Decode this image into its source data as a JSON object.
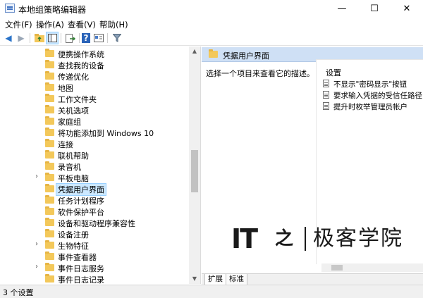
{
  "window": {
    "title": "本地组策略编辑器",
    "minimize": "—",
    "maximize": "☐",
    "close": "✕"
  },
  "menu": [
    "文件(F)",
    "操作(A)",
    "查看(V)",
    "帮助(H)"
  ],
  "toolbar": {
    "back": "◀",
    "forward": "▶",
    "filter_icon": "funnel-icon",
    "help": "?"
  },
  "tree": {
    "items": [
      {
        "label": "便携操作系统",
        "expandable": false
      },
      {
        "label": "查找我的设备",
        "expandable": false
      },
      {
        "label": "传递优化",
        "expandable": false
      },
      {
        "label": "地图",
        "expandable": false
      },
      {
        "label": "工作文件夹",
        "expandable": false
      },
      {
        "label": "关机选项",
        "expandable": false
      },
      {
        "label": "家庭组",
        "expandable": false
      },
      {
        "label": "将功能添加到 Windows 10",
        "expandable": false
      },
      {
        "label": "连接",
        "expandable": false
      },
      {
        "label": "联机帮助",
        "expandable": false
      },
      {
        "label": "录音机",
        "expandable": false
      },
      {
        "label": "平板电脑",
        "expandable": true
      },
      {
        "label": "凭据用户界面",
        "expandable": false,
        "selected": true
      },
      {
        "label": "任务计划程序",
        "expandable": false
      },
      {
        "label": "软件保护平台",
        "expandable": false
      },
      {
        "label": "设备和驱动程序兼容性",
        "expandable": false
      },
      {
        "label": "设备注册",
        "expandable": false
      },
      {
        "label": "生物特征",
        "expandable": true
      },
      {
        "label": "事件查看器",
        "expandable": false
      },
      {
        "label": "事件日志服务",
        "expandable": true
      },
      {
        "label": "事件日志记录",
        "expandable": false
      }
    ],
    "scroll_up": "▲",
    "scroll_down": "▼",
    "expand_glyph": "›"
  },
  "right": {
    "header": "凭据用户界面",
    "description": "选择一个项目来查看它的描述。",
    "settings_header": "设置",
    "settings": [
      "不显示\"密码显示\"按钮",
      "要求输入凭据的受信任路径",
      "提升时枚举管理员帐户"
    ],
    "tabs": [
      "扩展",
      "标准"
    ]
  },
  "status": {
    "text": "3 个设置"
  },
  "watermark": {
    "logo": "IT",
    "logo2": "之",
    "text": "极客学院"
  },
  "colors": {
    "selection": "#cce8ff",
    "header": "#cfe0f5",
    "folder": "#f3c85a"
  }
}
